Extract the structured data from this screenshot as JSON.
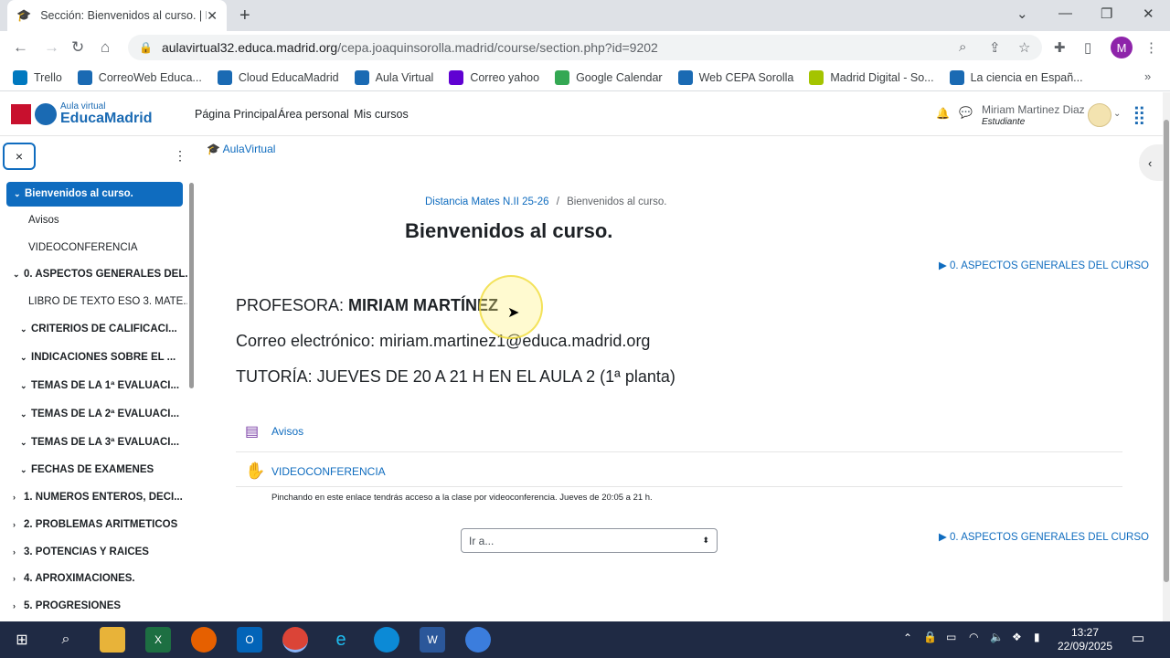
{
  "browser": {
    "tab_title": "Sección: Bienvenidos al curso. | D",
    "new_tab_icon": "plus-icon",
    "url_domain": "aulavirtual32.educa.madrid.org",
    "url_path": "/cepa.joaquinsorolla.madrid/course/section.php?id=9202",
    "profile_initial": "M",
    "bookmarks": [
      {
        "label": "Trello",
        "color": "#0079bf"
      },
      {
        "label": "CorreoWeb Educa...",
        "color": "#1a6ab3"
      },
      {
        "label": "Cloud EducaMadrid",
        "color": "#1a6ab3"
      },
      {
        "label": "Aula Virtual",
        "color": "#1a6ab3"
      },
      {
        "label": "Correo yahoo",
        "color": "#6001d2"
      },
      {
        "label": "Google Calendar",
        "color": "#34a853"
      },
      {
        "label": "Web CEPA Sorolla",
        "color": "#1a6ab3"
      },
      {
        "label": "Madrid Digital - So...",
        "color": "#a4c400"
      },
      {
        "label": "La ciencia en Españ...",
        "color": "#1a6ab3"
      }
    ]
  },
  "header": {
    "logo_line1": "Aula virtual",
    "logo_line2": "EducaMadrid",
    "nav": [
      "Página Principal",
      "Área personal",
      "Mis cursos"
    ],
    "user_name": "Miriam Martinez Diaz",
    "user_role": "Estudiante"
  },
  "sidebar": {
    "close_label": "×",
    "items": [
      {
        "label": "Bienvenidos al curso.",
        "chev": "⌄",
        "style": "active"
      },
      {
        "label": "Avisos",
        "chev": "",
        "style": "sub"
      },
      {
        "label": "VIDEOCONFERENCIA",
        "chev": "",
        "style": "sub"
      },
      {
        "label": "0. ASPECTOS GENERALES DEL...",
        "chev": "⌄",
        "style": "b"
      },
      {
        "label": "LIBRO DE TEXTO ESO 3. MATE...",
        "chev": "",
        "style": "sub"
      },
      {
        "label": "CRITERIOS DE CALIFICACI...",
        "chev": "⌄",
        "style": "b2"
      },
      {
        "label": "INDICACIONES SOBRE EL ...",
        "chev": "⌄",
        "style": "b2"
      },
      {
        "label": "TEMAS DE LA 1ª EVALUACI...",
        "chev": "⌄",
        "style": "b2"
      },
      {
        "label": "TEMAS DE LA 2ª EVALUACI...",
        "chev": "⌄",
        "style": "b2"
      },
      {
        "label": "TEMAS DE LA 3ª EVALUACI...",
        "chev": "⌄",
        "style": "b2"
      },
      {
        "label": "FECHAS DE EXÁMENES",
        "chev": "⌄",
        "style": "b2"
      },
      {
        "label": "1. NÚMEROS ENTEROS, DECI...",
        "chev": "›",
        "style": "b"
      },
      {
        "label": "2. PROBLEMAS ARITMÉTICOS",
        "chev": "›",
        "style": "b"
      },
      {
        "label": "3. POTENCIAS Y RAÍCES",
        "chev": "›",
        "style": "b"
      },
      {
        "label": "4. APROXIMACIONES.",
        "chev": "›",
        "style": "b"
      },
      {
        "label": "5. PROGRESIONES",
        "chev": "›",
        "style": "b"
      }
    ]
  },
  "main": {
    "crumb_top": "AulaVirtual",
    "breadcrumb_course": "Distancia Mates N.II 25-26",
    "breadcrumb_sep": "/",
    "breadcrumb_current": "Bienvenidos al curso.",
    "title": "Bienvenidos al curso.",
    "next_section": "▶ 0. ASPECTOS GENERALES DEL CURSO",
    "profesora_label": "PROFESORA: ",
    "profesora_name": "MIRIAM MARTÍNEZ",
    "email_line": "Correo electrónico: miriam.martinez1@educa.madrid.org",
    "tutoria_line": "TUTORÍA: JUEVES DE 20 A 21 H EN EL AULA 2 (1ª planta)",
    "activity_avisos": "Avisos",
    "activity_video": "VIDEOCONFERENCIA",
    "activity_video_desc": "Pinchando en este enlace tendrás acceso a la clase por videoconferencia. Jueves de 20:05 a 21 h.",
    "jump_select": "Ir a..."
  },
  "taskbar": {
    "time": "13:27",
    "date": "22/09/2025"
  }
}
